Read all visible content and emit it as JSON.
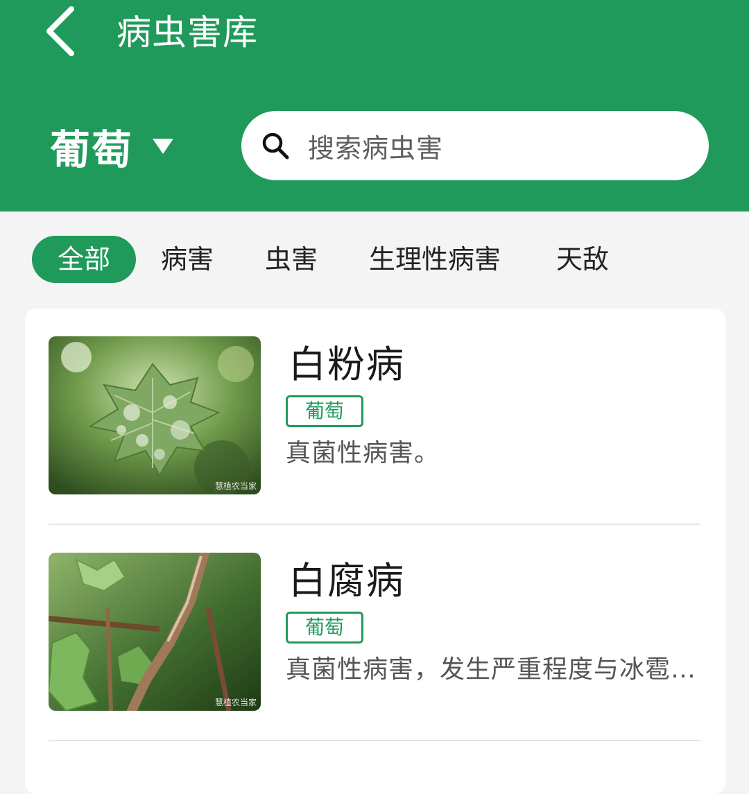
{
  "header": {
    "title": "病虫害库",
    "crop": "葡萄",
    "search_placeholder": "搜索病虫害",
    "background_color": "#209a5b"
  },
  "tabs": [
    {
      "label": "全部",
      "active": true
    },
    {
      "label": "病害",
      "active": false
    },
    {
      "label": "虫害",
      "active": false
    },
    {
      "label": "生理性病害",
      "active": false
    },
    {
      "label": "天敌",
      "active": false
    }
  ],
  "items": [
    {
      "title": "白粉病",
      "tag": "葡萄",
      "description": "真菌性病害。",
      "image_icon": "grape-leaf-powdery-mildew-photo",
      "watermark": "慧植农当家"
    },
    {
      "title": "白腐病",
      "tag": "葡萄",
      "description": "真菌性病害，发生严重程度与冰雹、暴雨等天气相关",
      "image_icon": "grape-cane-white-rot-photo",
      "watermark": "慧植农当家"
    }
  ],
  "accent_color": "#209a5b"
}
